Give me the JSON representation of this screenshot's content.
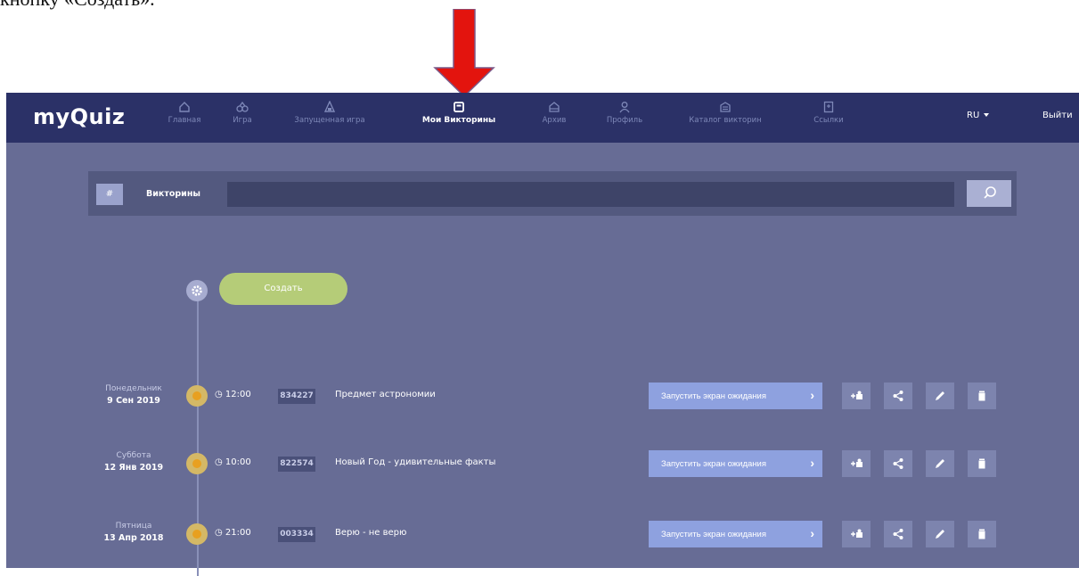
{
  "document": {
    "text_fragment": "кнопку «Создать»."
  },
  "navbar": {
    "logo": "myQuiz",
    "items": [
      {
        "label": "Главная",
        "icon": "home-icon"
      },
      {
        "label": "Игра",
        "icon": "game-icon"
      },
      {
        "label": "Запущенная игра",
        "icon": "launched-game-icon"
      },
      {
        "label": "Мои Викторины",
        "icon": "my-quizzes-icon",
        "active": true
      },
      {
        "label": "Архив",
        "icon": "archive-icon"
      },
      {
        "label": "Профиль",
        "icon": "profile-icon"
      },
      {
        "label": "Каталог викторин",
        "icon": "catalog-icon"
      },
      {
        "label": "Ссылки",
        "icon": "links-icon"
      }
    ],
    "language": "RU",
    "logout": "Выйти"
  },
  "search": {
    "hash": "#",
    "label": "Викторины",
    "value": "",
    "button_icon": "search-icon"
  },
  "create_button": "Создать",
  "quizzes": [
    {
      "day": "Понедельник",
      "date": "9 Сен 2019",
      "time": "12:00",
      "code": "834227",
      "name": "Предмет астрономии",
      "launch": "Запустить экран ожидания"
    },
    {
      "day": "Суббота",
      "date": "12 Янв 2019",
      "time": "10:00",
      "code": "822574",
      "name": "Новый Год - удивительные факты",
      "launch": "Запустить экран ожидания"
    },
    {
      "day": "Пятница",
      "date": "13 Апр 2018",
      "time": "21:00",
      "code": "003334",
      "name": "Верю - не верю",
      "launch": "Запустить экран ожидания"
    }
  ],
  "colors": {
    "navbar": "#2b3167",
    "background": "#676c95",
    "create": "#b5cc78",
    "launch": "#8ea1df",
    "arrow": "#e3140e"
  }
}
